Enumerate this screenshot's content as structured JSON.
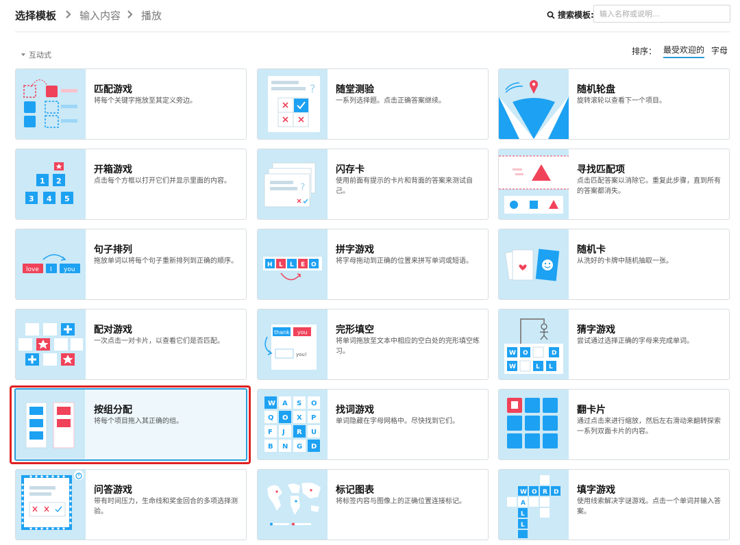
{
  "breadcrumb": {
    "step1": "选择模板",
    "step2": "输入内容",
    "step3": "播放"
  },
  "search": {
    "label": "搜索模板:",
    "placeholder": "输入名称或说明..."
  },
  "filter": {
    "section": "互动式",
    "sort_label": "排序：",
    "sort_options": [
      "最受欢迎的",
      "字母"
    ]
  },
  "colors": {
    "accent": "#2b9bd9",
    "thumb_bg": "#cbe9f7",
    "tile_blue": "#1da1f2",
    "tile_red": "#f0435a",
    "highlight": "#e02020"
  },
  "templates": [
    {
      "title": "匹配游戏",
      "desc": "将每个关键字拖放至其定义旁边。",
      "icon": "match-up-icon"
    },
    {
      "title": "随堂测验",
      "desc": "一系列选择题。点击正确答案继续。",
      "icon": "quiz-icon"
    },
    {
      "title": "随机轮盘",
      "desc": "旋转滚轮以查看下一个项目。",
      "icon": "wheel-icon"
    },
    {
      "title": "开箱游戏",
      "desc": "点击每个方框以打开它们并显示里面的内容。",
      "icon": "open-box-icon"
    },
    {
      "title": "闪存卡",
      "desc": "使用前面有提示的卡片和背面的答案来测试自己。",
      "icon": "flash-cards-icon"
    },
    {
      "title": "寻找匹配项",
      "desc": "点击匹配答案以消除它。重复此步骤，直到所有的答案都消失。",
      "icon": "find-match-icon"
    },
    {
      "title": "句子排列",
      "desc": "拖放单词以将每个句子重新排列到正确的顺序。",
      "icon": "unjumble-icon"
    },
    {
      "title": "拼字游戏",
      "desc": "将字母拖动到正确的位置来拼写单词或短语。",
      "icon": "anagram-icon"
    },
    {
      "title": "随机卡",
      "desc": "从洗好的卡牌中随机抽取一张。",
      "icon": "random-cards-icon"
    },
    {
      "title": "配对游戏",
      "desc": "一次点击一对卡片，以查看它们是否匹配。",
      "icon": "matching-pairs-icon"
    },
    {
      "title": "完形填空",
      "desc": "将单词拖放至文本中相应的空白处的完形填空练习。",
      "icon": "complete-sentence-icon"
    },
    {
      "title": "猜字游戏",
      "desc": "尝试通过选择正确的字母来完成单词。",
      "icon": "hangman-icon"
    },
    {
      "title": "按组分配",
      "desc": "将每个项目拖入其正确的组。",
      "icon": "group-sort-icon"
    },
    {
      "title": "找词游戏",
      "desc": "单词隐藏在字母网格中。尽快找到它们。",
      "icon": "wordsearch-icon"
    },
    {
      "title": "翻卡片",
      "desc": "通过点击来进行缩放，然后左右滑动来翻转探索一系列双面卡片的内容。",
      "icon": "flip-tiles-icon"
    },
    {
      "title": "问答游戏",
      "desc": "带有时间压力，生命线和奖金回合的多项选择测验。",
      "icon": "gameshow-quiz-icon"
    },
    {
      "title": "标记图表",
      "desc": "将标签内容与图像上的正确位置连接标记。",
      "icon": "labelled-diagram-icon"
    },
    {
      "title": "填字游戏",
      "desc": "使用线索解决字谜游戏。点击一个单词并输入答案。",
      "icon": "crossword-icon"
    }
  ],
  "thumb_text": {
    "open_box": [
      "1",
      "2",
      "3",
      "4",
      "5"
    ],
    "unjumble": [
      "love",
      "I",
      "you"
    ],
    "anagram": [
      "H",
      "L",
      "L",
      "E",
      "O"
    ],
    "complete": [
      "thank",
      "you",
      "you!"
    ],
    "hangman": [
      "W",
      "O",
      "D",
      "W",
      "L",
      "L"
    ],
    "wordsearch": [
      "W",
      "A",
      "S",
      "O",
      "Q",
      "O",
      "X",
      "P",
      "F",
      "J",
      "R",
      "U",
      "B",
      "N",
      "G",
      "D"
    ],
    "crossword": [
      "W",
      "O",
      "R",
      "D",
      "A",
      "L",
      "L"
    ],
    "quiz_marks": [
      "?"
    ]
  }
}
